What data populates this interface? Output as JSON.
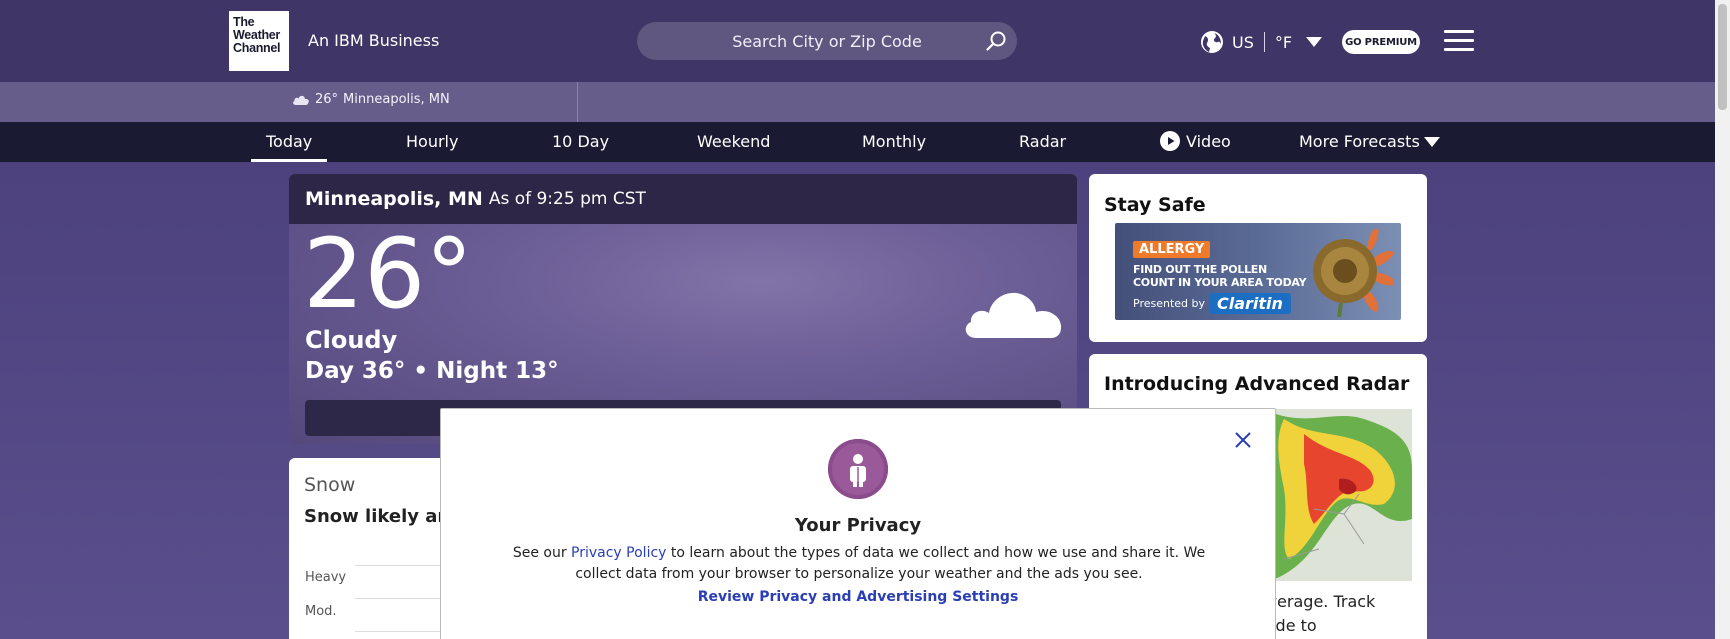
{
  "header": {
    "logo_lines": [
      "The",
      "Weather",
      "Channel"
    ],
    "tagline": "An IBM Business",
    "search_placeholder": "Search City or Zip Code",
    "country": "US",
    "unit": "°F",
    "premium_label": "GO PREMIUM"
  },
  "recent_location": {
    "temp": "26°",
    "city": "Minneapolis, MN"
  },
  "nav": {
    "items": [
      "Today",
      "Hourly",
      "10 Day",
      "Weekend",
      "Monthly",
      "Radar",
      "Video",
      "More Forecasts"
    ],
    "active": "Today"
  },
  "current": {
    "city": "Minneapolis, MN",
    "as_of": "As of 9:25 pm CST",
    "temp": "26°",
    "phrase": "Cloudy",
    "day_night": "Day 36° • Night 13°"
  },
  "snow": {
    "title": "Snow",
    "description": "Snow likely arou",
    "levels": [
      "Heavy",
      "Mod."
    ]
  },
  "stay_safe": {
    "title": "Stay Safe",
    "ad": {
      "badge": "ALLERGY",
      "line1": "FIND OUT THE POLLEN",
      "line2": "COUNT IN YOUR AREA TODAY",
      "presented": "Presented by",
      "brand": "Claritin"
    }
  },
  "radar_card": {
    "title": "Introducing Advanced Radar",
    "text_line1": "coverage. Track",
    "text_line2": "grade to"
  },
  "privacy": {
    "title": "Your Privacy",
    "body_prefix": "See our ",
    "policy_link": "Privacy Policy",
    "body_suffix": " to learn about the types of data we collect and how we use and share it. We collect data from your browser to personalize your weather and the ads you see.",
    "settings_link": "Review Privacy and Advertising Settings"
  },
  "colors": {
    "header_bg": "#3f3566",
    "nav_bg": "#1b1a33",
    "link_blue": "#2a3eb5",
    "privacy_icon": "#8e4b8e"
  }
}
